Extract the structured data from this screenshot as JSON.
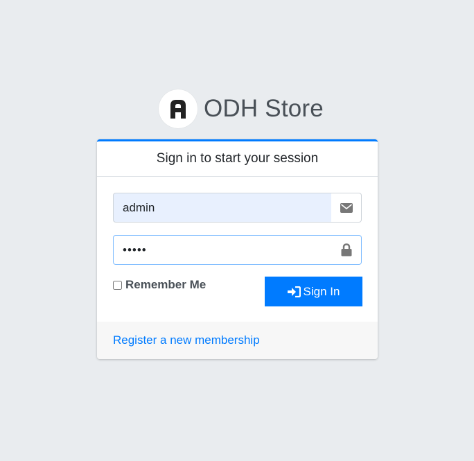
{
  "brand": {
    "name": "ODH Store",
    "logo_letter": "A"
  },
  "login": {
    "header": "Sign in to start your session",
    "email": {
      "value": "admin",
      "icon": "envelope-icon"
    },
    "password": {
      "value": "•••••",
      "icon": "lock-icon"
    },
    "remember_label": "Remember Me",
    "remember_checked": false,
    "submit_label": "Sign In",
    "submit_icon": "sign-in-icon",
    "register_link": "Register a new membership"
  },
  "colors": {
    "accent": "#007bff",
    "background": "#e9ecef",
    "autofill": "#e8f0fe"
  }
}
